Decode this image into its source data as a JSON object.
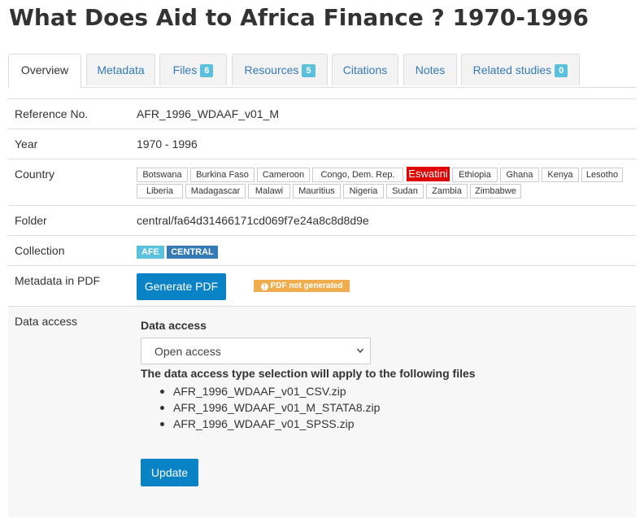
{
  "page": {
    "title": "What Does Aid to Africa Finance ? 1970-1996"
  },
  "tabs": [
    {
      "label": "Overview",
      "count": null,
      "active": true
    },
    {
      "label": "Metadata",
      "count": null,
      "active": false
    },
    {
      "label": "Files",
      "count": "6",
      "active": false
    },
    {
      "label": "Resources",
      "count": "5",
      "active": false
    },
    {
      "label": "Citations",
      "count": null,
      "active": false
    },
    {
      "label": "Notes",
      "count": null,
      "active": false
    },
    {
      "label": "Related studies",
      "count": "0",
      "active": false
    }
  ],
  "fields": {
    "reference": {
      "label": "Reference No.",
      "value": "AFR_1996_WDAAF_v01_M"
    },
    "year": {
      "label": "Year",
      "value": "1970 - 1996"
    },
    "country": {
      "label": "Country",
      "highlighted": "Eswatini",
      "values": [
        "Botswana",
        "Burkina Faso",
        "Cameroon",
        "Congo, Dem. Rep.",
        "Eswatini",
        "Ethiopia",
        "Ghana",
        "Kenya",
        "Lesotho",
        "Liberia",
        "Madagascar",
        "Malawi",
        "Mauritius",
        "Nigeria",
        "Sudan",
        "Zambia",
        "Zimbabwe"
      ]
    },
    "folder": {
      "label": "Folder",
      "value": "central/fa64d31466171cd069f7e24a8c8d8d9e"
    },
    "collection": {
      "label": "Collection",
      "values": [
        "AFE",
        "CENTRAL"
      ]
    },
    "metadata_pdf": {
      "label": "Metadata in PDF",
      "button_label": "Generate PDF",
      "status": "PDF not generated"
    },
    "data_access": {
      "label": "Data access",
      "heading": "Data access",
      "selected": "Open access",
      "note": "The data access type selection will apply to the following files",
      "files": [
        "AFR_1996_WDAAF_v01_CSV.zip",
        "AFR_1996_WDAAF_v01_M_STATA8.zip",
        "AFR_1996_WDAAF_v01_SPSS.zip"
      ],
      "update_label": "Update"
    }
  },
  "colors": {
    "accent": "#0a83c6",
    "link": "#337ab7",
    "badge": "#5bc0de",
    "highlight": "#e00000",
    "warning": "#f0ad4e",
    "collection_afe": "#5bc0de",
    "collection_central": "#337ab7"
  },
  "icons": {
    "warning": "exclamation-circle-icon",
    "select": "chevron-down-icon"
  }
}
